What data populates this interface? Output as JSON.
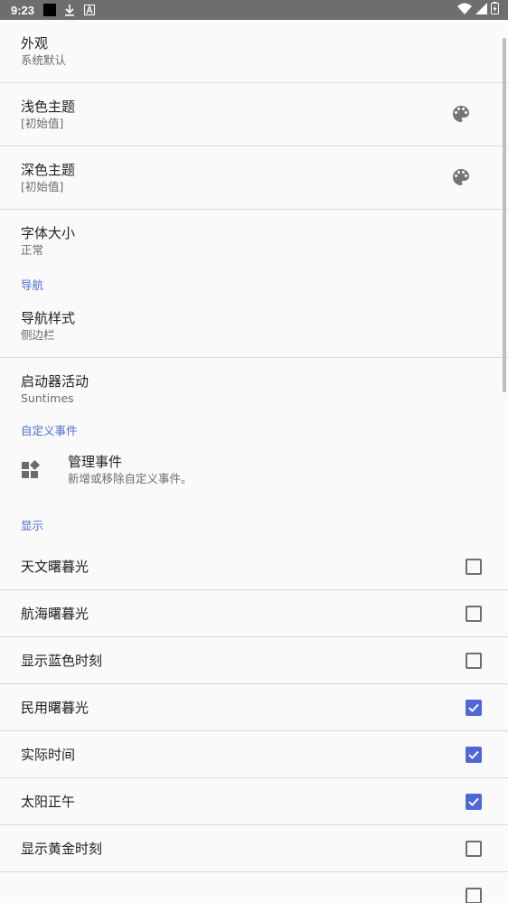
{
  "status_bar": {
    "time": "9:23"
  },
  "appearance": {
    "title": "外观",
    "summary": "系统默认"
  },
  "light_theme": {
    "title": "浅色主题",
    "summary": "[初始值]",
    "icon": "palette-icon"
  },
  "dark_theme": {
    "title": "深色主题",
    "summary": "[初始值]",
    "icon": "palette-icon"
  },
  "font_size": {
    "title": "字体大小",
    "summary": "正常"
  },
  "nav_category": "导航",
  "nav_style": {
    "title": "导航样式",
    "summary": "侧边栏"
  },
  "launcher": {
    "title": "启动器活动",
    "summary": "Suntimes"
  },
  "custom_events_category": "自定义事件",
  "manage_events": {
    "title": "管理事件",
    "summary": "新增或移除自定义事件。",
    "icon": "widgets-icon"
  },
  "display_category": "显示",
  "display_items": [
    {
      "label": "天文曙暮光",
      "checked": false
    },
    {
      "label": "航海曙暮光",
      "checked": false
    },
    {
      "label": "显示蓝色时刻",
      "checked": false
    },
    {
      "label": "民用曙暮光",
      "checked": true
    },
    {
      "label": "实际时间",
      "checked": true
    },
    {
      "label": "太阳正午",
      "checked": true
    },
    {
      "label": "显示黄金时刻",
      "checked": false
    },
    {
      "label": "",
      "checked": false
    }
  ],
  "colors": {
    "accent": "#5067d6",
    "category": "#4e6cd7",
    "status_bar": "#6e6e6e",
    "background": "#fafafa"
  }
}
